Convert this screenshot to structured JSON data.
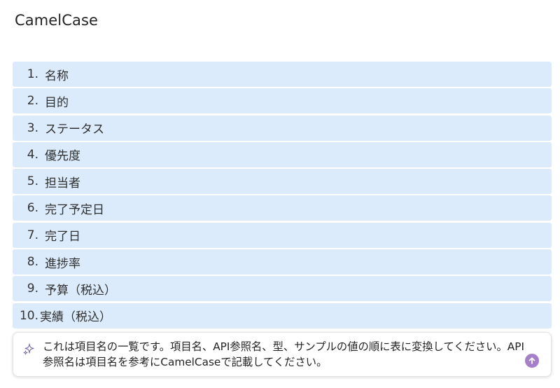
{
  "page": {
    "title": "CamelCase"
  },
  "list": {
    "items": [
      {
        "num": "1.",
        "label": "名称"
      },
      {
        "num": "2.",
        "label": "目的"
      },
      {
        "num": "3.",
        "label": "ステータス"
      },
      {
        "num": "4.",
        "label": "優先度"
      },
      {
        "num": "5.",
        "label": "担当者"
      },
      {
        "num": "6.",
        "label": "完了予定日"
      },
      {
        "num": "7.",
        "label": "完了日"
      },
      {
        "num": "8.",
        "label": "進捗率"
      },
      {
        "num": "9.",
        "label": "予算（税込）"
      },
      {
        "num": "10.",
        "label": "実績（税込）"
      }
    ]
  },
  "chat": {
    "message": "これは項目名の一覧です。項目名、API参照名、型、サンプルの値の順に表に変換してください。API参照名は項目名を参考にCamelCaseで記載してください。",
    "sparkle_icon": "sparkle-icon",
    "send_icon": "send-arrow-up-icon",
    "accent_color": "#a57fc9"
  },
  "colors": {
    "list_item_bg": "#dcebfb"
  }
}
